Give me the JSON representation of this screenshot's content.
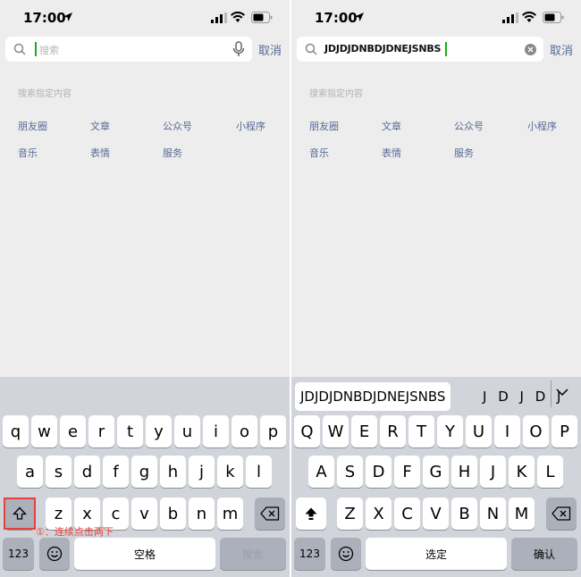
{
  "status_bar": {
    "time": "17:00"
  },
  "left_panel": {
    "search": {
      "placeholder": "搜索",
      "value": ""
    },
    "cancel_label": "取消",
    "section_title": "搜索指定内容",
    "categories": [
      "朋友圈",
      "文章",
      "公众号",
      "小程序",
      "音乐",
      "表情",
      "服务"
    ],
    "keyboard": {
      "row1": [
        "q",
        "w",
        "e",
        "r",
        "t",
        "y",
        "u",
        "i",
        "o",
        "p"
      ],
      "row2": [
        "a",
        "s",
        "d",
        "f",
        "g",
        "h",
        "j",
        "k",
        "l"
      ],
      "row3": [
        "z",
        "x",
        "c",
        "v",
        "b",
        "n",
        "m"
      ],
      "numbers_label": "123",
      "space_label": "空格",
      "action_label": "搜索",
      "shift_state": "off"
    },
    "annotation": "①：连续点击两下"
  },
  "right_panel": {
    "search": {
      "placeholder": "搜索",
      "value": "JDJDJDNBDJDNEJSNBS"
    },
    "cancel_label": "取消",
    "section_title": "搜索指定内容",
    "categories": [
      "朋友圈",
      "文章",
      "公众号",
      "小程序",
      "音乐",
      "表情",
      "服务"
    ],
    "suggestion": {
      "primary": "JDJDJDNBDJDNEJSNBS",
      "secondary": "J D J D J"
    },
    "keyboard": {
      "row1": [
        "Q",
        "W",
        "E",
        "R",
        "T",
        "Y",
        "U",
        "I",
        "O",
        "P"
      ],
      "row2": [
        "A",
        "S",
        "D",
        "F",
        "G",
        "H",
        "J",
        "K",
        "L"
      ],
      "row3": [
        "Z",
        "X",
        "C",
        "V",
        "B",
        "N",
        "M"
      ],
      "numbers_label": "123",
      "space_label": "选定",
      "action_label": "确认",
      "shift_state": "caps-lock"
    }
  },
  "colors": {
    "link": "#576b95",
    "cursor": "#1aad19",
    "annotation": "#e8403b",
    "keyboard_bg": "#d1d4da"
  },
  "icons": [
    "location-arrow-icon",
    "signal-icon",
    "wifi-icon",
    "battery-icon",
    "search-icon",
    "mic-icon",
    "clear-icon",
    "shift-icon",
    "backspace-icon",
    "emoji-icon",
    "chevron-down-icon"
  ]
}
